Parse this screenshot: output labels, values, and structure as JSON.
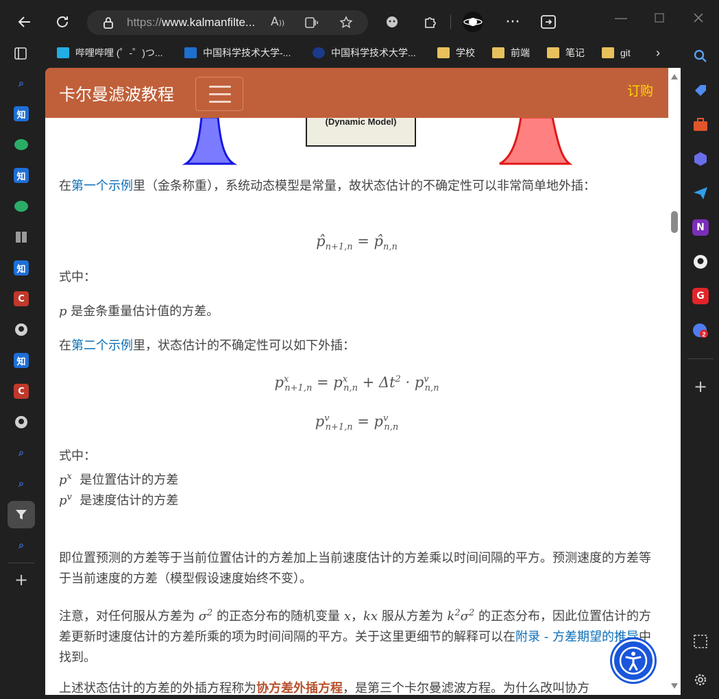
{
  "browser": {
    "url_prefix": "https://",
    "url_domain": "www.kalmanfilte...",
    "bookmarks": [
      {
        "label": "哔哩哔哩 (゜-゜)つ..."
      },
      {
        "label": "中国科学技术大学-..."
      },
      {
        "label": "中国科学技术大学..."
      },
      {
        "label": "学校"
      },
      {
        "label": "前端"
      },
      {
        "label": "笔记"
      },
      {
        "label": "git"
      }
    ]
  },
  "navbar": {
    "brand": "卡尔曼滤波教程",
    "subscribe": "订购"
  },
  "figure": {
    "box_label": "(Dynamic Model)"
  },
  "content": {
    "p1_pre": "在",
    "p1_link": "第一个示例",
    "p1_post": "里（金条称重），系统动态模型是常量，故状态估计的不确定性可以非常简单地外插：",
    "where1": "式中：",
    "p_var": "p",
    "p_desc": "是金条重量估计值的方差。",
    "p2_pre": "在",
    "p2_link": "第二个示例",
    "p2_post": "里，状态估计的不确定性可以如下外插：",
    "where2": "式中：",
    "px_desc": "是位置估计的方差",
    "pv_desc": "是速度估计的方差",
    "p3": "即位置预测的方差等于当前位置估计的方差加上当前速度估计的方差乘以时间间隔的平方。预测速度的方差等于当前速度的方差（模型假设速度始终不变）。",
    "p4_a": "注意，对任何服从方差为",
    "p4_b": "的正态分布的随机变量",
    "p4_c": "服从方差为",
    "p4_d": "的正态分布，因此位置估计的方差更新时速度估计的方差所乘的项为时间间隔的平方。关于这里更细节的解释可以在",
    "p4_link": "附录 - 方差期望的推导",
    "p4_e": "中找到。",
    "p5_a": "上述状态估计的方差的外插方程称为",
    "p5_link": "协方差外插方程",
    "p5_b": "，是第三个卡尔曼滤波方程。为什么改叫协方"
  }
}
